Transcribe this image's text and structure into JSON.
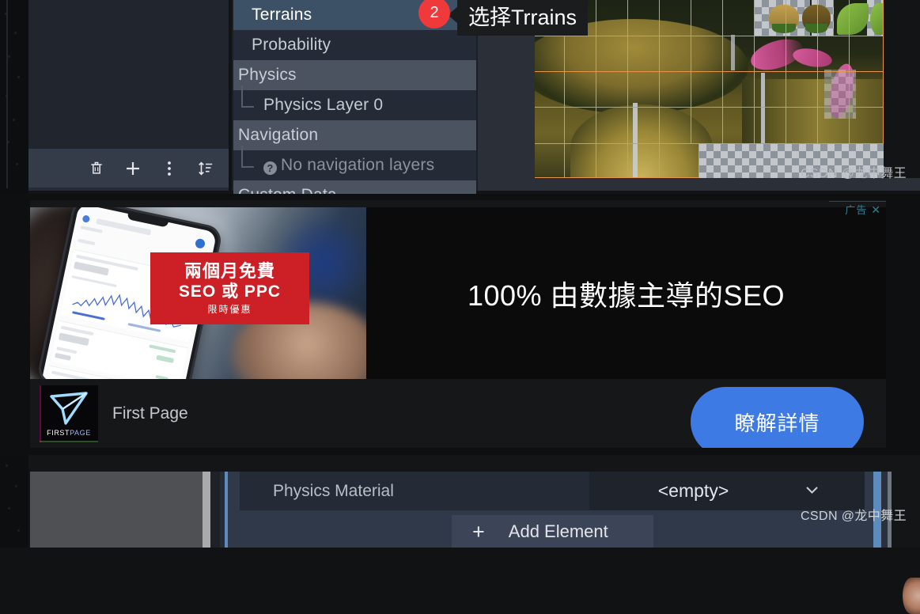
{
  "editor": {
    "terrain_panel": {
      "rows": [
        {
          "label": "Terrains",
          "kind": "selected"
        },
        {
          "label": "Probability",
          "kind": "plain"
        },
        {
          "label": "Physics",
          "kind": "header"
        },
        {
          "label": "Physics Layer 0",
          "kind": "child"
        },
        {
          "label": "Navigation",
          "kind": "header"
        },
        {
          "label": "No navigation layers",
          "kind": "child-muted"
        },
        {
          "label": "Custom Data",
          "kind": "header"
        }
      ]
    },
    "left_toolbar": {
      "icons": [
        "trash-icon",
        "plus-icon",
        "more-vertical-icon",
        "sort-icon"
      ]
    },
    "callout": {
      "text": "选择Trrains",
      "badge": "2",
      "badge_color": "#f0393b"
    },
    "watermark_top": "CSDN @龙中舞王"
  },
  "ad": {
    "label": "广告",
    "close_glyph": "✕",
    "label_color": "#2f7f93",
    "creative": {
      "red_box": {
        "line1": "兩個月免費",
        "line2": "SEO 或 PPC",
        "line3": "限時優惠",
        "color": "#cd2026"
      },
      "headline": "100% 由數據主導的SEO"
    },
    "advertiser": "First Page",
    "logo_word_a": "FIRST",
    "logo_word_b": "PAGE",
    "cta": "瞭解詳情",
    "cta_color": "#3d7ae4"
  },
  "inspector_bottom": {
    "property_label": "Physics Material",
    "property_value": "<empty>",
    "chevron": "⌄",
    "add_element": "Add Element",
    "add_plus": "+",
    "watermark": "CSDN @龙中舞王"
  }
}
